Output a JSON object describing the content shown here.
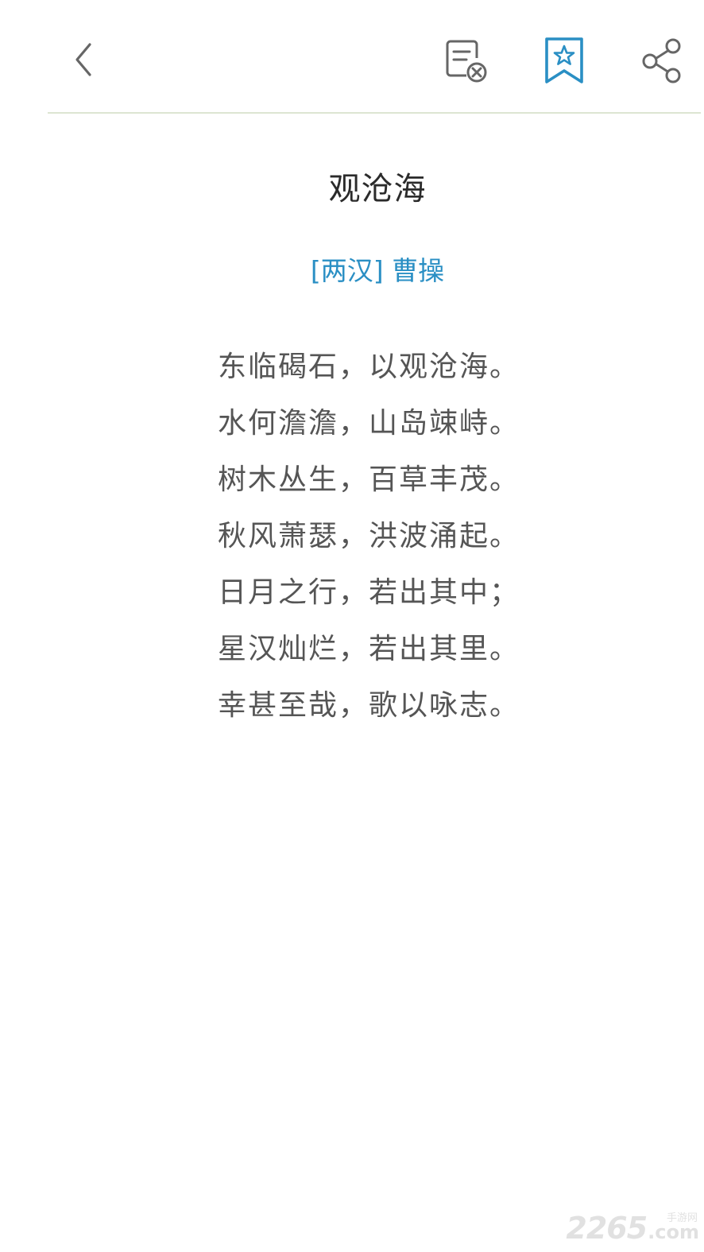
{
  "toolbar": {
    "back_icon": "chevron-left-icon",
    "clear_icon": "document-x-icon",
    "bookmark_icon": "bookmark-star-icon",
    "share_icon": "share-icon",
    "accent_color": "#2a8fc4",
    "icon_color": "#666666"
  },
  "poem": {
    "title": "观沧海",
    "author": "[两汉] 曹操",
    "lines": [
      "东临碣石，以观沧海。",
      "水何澹澹，山岛竦峙。",
      "树木丛生，百草丰茂。",
      "秋风萧瑟，洪波涌起。",
      "日月之行，若出其中；",
      "星汉灿烂，若出其里。",
      "幸甚至哉，歌以咏志。"
    ]
  },
  "watermark": {
    "number": "2265",
    "suffix": ".com",
    "text": "手游网"
  }
}
